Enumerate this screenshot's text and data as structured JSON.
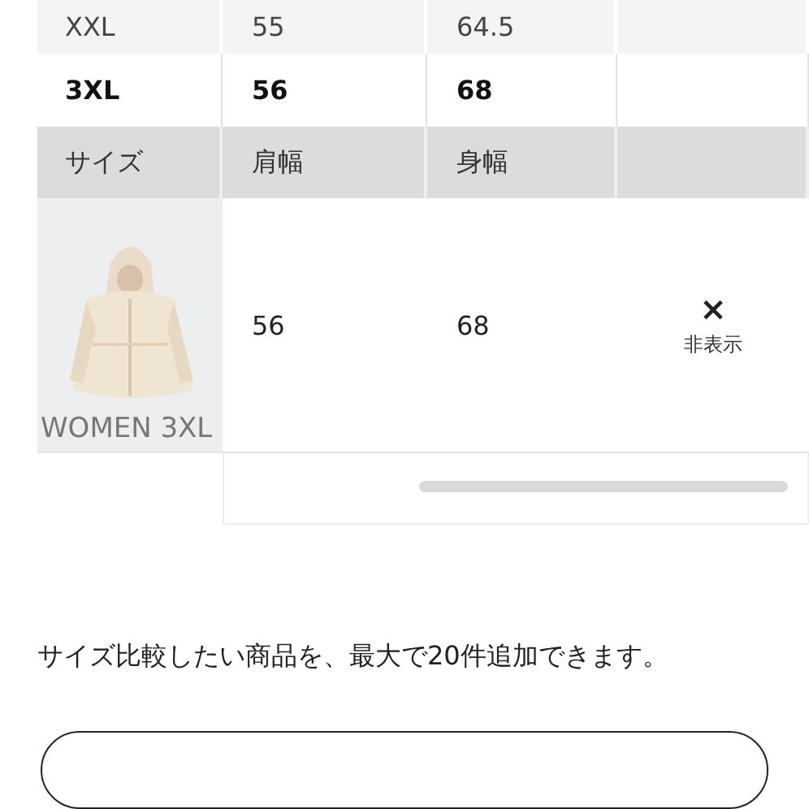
{
  "size_rows": [
    {
      "kind": "size",
      "size": "XXL",
      "shoulder": "55",
      "body": "64.5",
      "selected": false
    },
    {
      "kind": "size",
      "size": "3XL",
      "shoulder": "56",
      "body": "68",
      "selected": true
    }
  ],
  "header": {
    "size": "サイズ",
    "shoulder": "肩幅",
    "body": "身幅"
  },
  "product": {
    "kind": "picture",
    "caption": "WOMEN 3XL",
    "shoulder": "56",
    "body": "68",
    "hide_icon": "×",
    "hide_label": "非表示"
  },
  "note": "サイズ比較したい商品を、最大で20件追加できます。"
}
